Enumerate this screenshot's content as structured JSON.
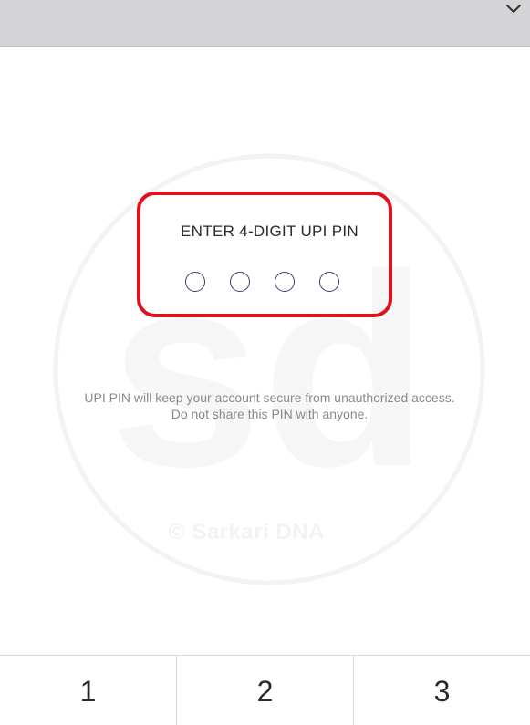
{
  "header": {
    "collapse_icon": "chevron-down-icon",
    "background_color": "#d4d3d6"
  },
  "pin_entry": {
    "title": "ENTER 4-DIGIT UPI PIN",
    "digit_count": 4,
    "highlight_color": "#e0101c"
  },
  "info": {
    "line1": "UPI PIN will keep your account secure from unauthorized access.",
    "line2": "Do not share this PIN with anyone."
  },
  "watermark": {
    "logo_text": "sd",
    "text": "© Sarkari DNA"
  },
  "keypad": {
    "keys": [
      "1",
      "2",
      "3"
    ]
  }
}
